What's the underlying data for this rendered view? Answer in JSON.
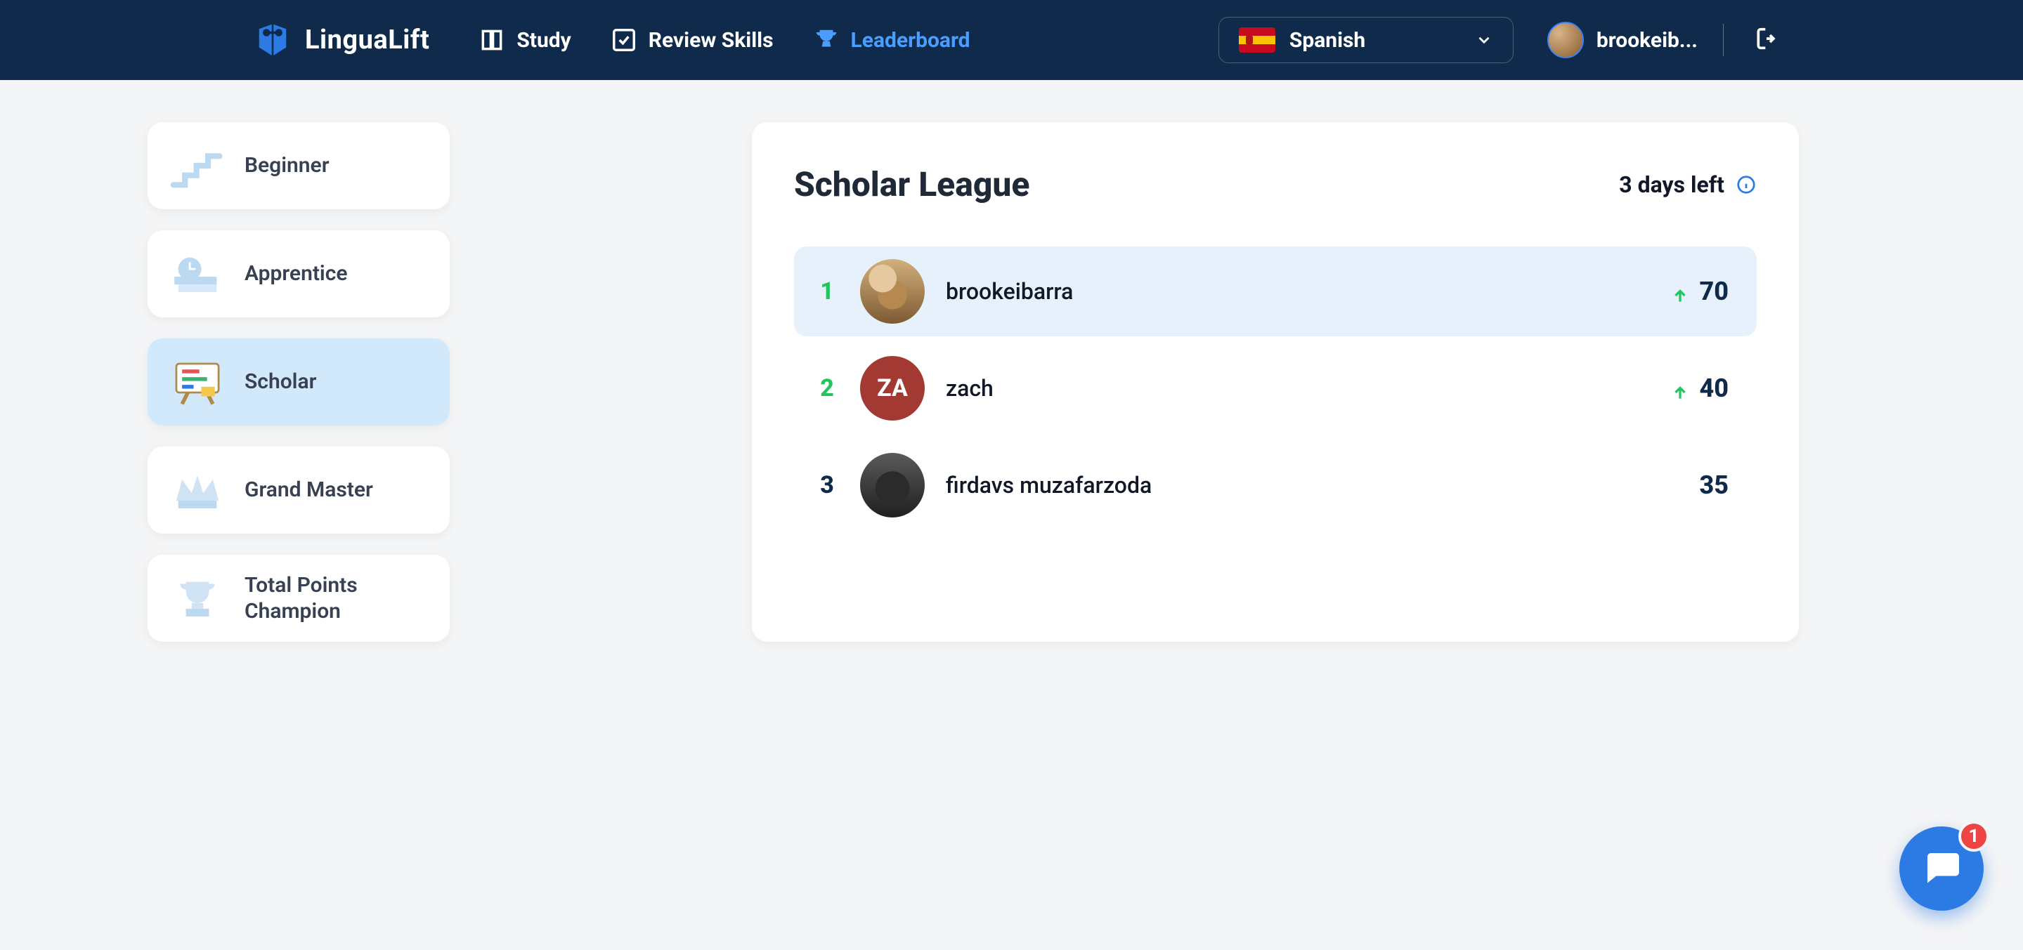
{
  "brand": {
    "name": "LinguaLift"
  },
  "nav": {
    "study": "Study",
    "review": "Review Skills",
    "leaderboard": "Leaderboard"
  },
  "language": {
    "current": "Spanish"
  },
  "user": {
    "display": "brookeib..."
  },
  "sidebar": {
    "items": [
      {
        "label": "Beginner"
      },
      {
        "label": "Apprentice"
      },
      {
        "label": "Scholar"
      },
      {
        "label": "Grand Master"
      },
      {
        "label": "Total Points Champion"
      }
    ]
  },
  "league": {
    "title": "Scholar League",
    "time_left": "3 days left",
    "rows": [
      {
        "rank": "1",
        "name": "brookeibarra",
        "points": "70",
        "initials": "",
        "trend": "up",
        "me": true
      },
      {
        "rank": "2",
        "name": "zach",
        "points": "40",
        "initials": "ZA",
        "trend": "up",
        "me": false
      },
      {
        "rank": "3",
        "name": "firdavs muzafarzoda",
        "points": "35",
        "initials": "",
        "trend": "none",
        "me": false
      }
    ]
  },
  "chat": {
    "unread": "1"
  }
}
